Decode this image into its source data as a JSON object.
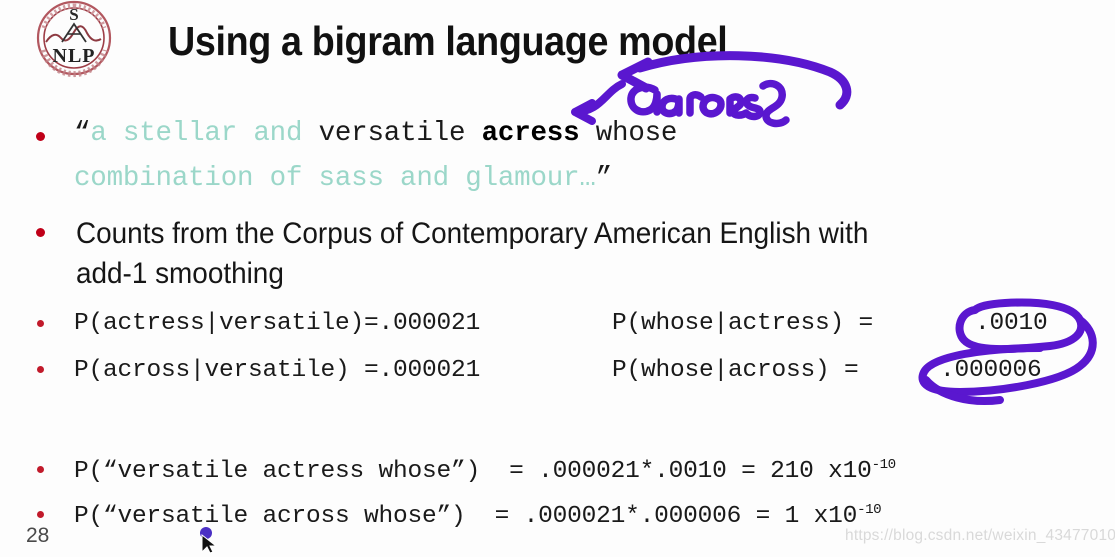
{
  "slide": {
    "title": "Using a bigram language model",
    "page_number": "28",
    "watermark": "https://blog.csdn.net/weixin_43477010",
    "background_color": "#fdfdfd"
  },
  "logo": {
    "name": "snlp-circular-seal-logo",
    "top_letter": "S",
    "bottom_letters": "NLP",
    "ring_text_top": "Natural Language Processing",
    "color": "#a03a44"
  },
  "colors": {
    "bullet": "#c00018",
    "quote_teal": "#9bd7c9",
    "ink_purple": "#5a17cf",
    "body_text": "#1a1a1a",
    "watermark": "#d9d9d9"
  },
  "bullets": [
    {
      "id": "quote",
      "line1": {
        "open_quote": "“",
        "teal_part": "a stellar and ",
        "black_part": "versatile ",
        "bold_part": "acress",
        "tail_part": " whose"
      },
      "line2": {
        "teal_part": "combination of sass and glamour…",
        "close_quote": "”"
      }
    },
    {
      "id": "counts",
      "line1": "Counts from the Corpus of Contemporary American English with",
      "line2": "add-1 smoothing"
    },
    {
      "id": "prob-actress",
      "left": "P(actress|versatile)=.000021",
      "right_label": "P(whose|actress) =",
      "right_value": ".0010",
      "value_circled": true
    },
    {
      "id": "prob-across",
      "left": "P(across|versatile) =.000021",
      "right_label": "P(whose|across) =",
      "right_value": ".000006",
      "value_circled": true
    },
    {
      "id": "seq-actress",
      "expression": "P(“versatile actress whose”)  = .000021*.0010 = 210 x10",
      "exponent": "-10"
    },
    {
      "id": "seq-across",
      "expression": "P(“versatile across whose”)  = .000021*.000006 = 1 x10",
      "exponent": "-10"
    }
  ],
  "annotations": {
    "handwritten_word": "across",
    "ink_color": "#5a17cf",
    "marks": [
      "left-arrow-to-acress",
      "handwritten-across-label",
      "right-curved-arrow",
      "circle-around-0010",
      "circle-around-000006"
    ]
  }
}
